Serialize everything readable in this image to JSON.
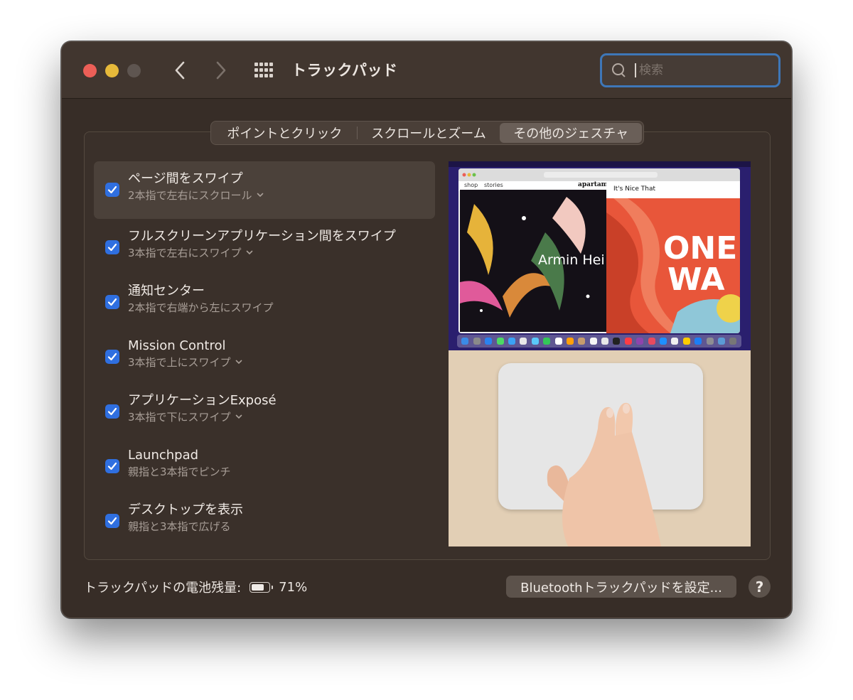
{
  "window": {
    "title": "トラックパッド",
    "traffic_colors": {
      "close": "#ec5f57",
      "minimize": "#e6b93a",
      "zoom": "#5e5550"
    }
  },
  "toolbar": {
    "back_icon": "chevron-left-icon",
    "forward_icon": "chevron-right-icon",
    "grid_icon": "grid-icon"
  },
  "search": {
    "placeholder": "検索",
    "value": ""
  },
  "tabs": [
    {
      "label": "ポイントとクリック",
      "selected": false
    },
    {
      "label": "スクロールとズーム",
      "selected": false
    },
    {
      "label": "その他のジェスチャ",
      "selected": true
    }
  ],
  "gestures": [
    {
      "title": "ページ間をスワイプ",
      "subtitle": "2本指で左右にスクロール",
      "checked": true,
      "has_menu": true,
      "selected": true
    },
    {
      "title": "フルスクリーンアプリケーション間をスワイプ",
      "subtitle": "3本指で左右にスワイプ",
      "checked": true,
      "has_menu": true,
      "selected": false
    },
    {
      "title": "通知センター",
      "subtitle": "2本指で右端から左にスワイプ",
      "checked": true,
      "has_menu": false,
      "selected": false
    },
    {
      "title": "Mission Control",
      "subtitle": "3本指で上にスワイプ",
      "checked": true,
      "has_menu": true,
      "selected": false
    },
    {
      "title": "アプリケーションExposé",
      "subtitle": "3本指で下にスワイプ",
      "checked": true,
      "has_menu": true,
      "selected": false
    },
    {
      "title": "Launchpad",
      "subtitle": "親指と3本指でピンチ",
      "checked": true,
      "has_menu": false,
      "selected": false
    },
    {
      "title": "デスクトップを表示",
      "subtitle": "親指と3本指で広げる",
      "checked": true,
      "has_menu": false,
      "selected": false
    }
  ],
  "preview": {
    "site_nav_left": "shop",
    "site_nav_right": "stories",
    "site_brand": "apartame",
    "site_brand2": "It's Nice That",
    "art_text_left": "Armin Hei",
    "art_text_right_1": "ONE",
    "art_text_right_2": "WA"
  },
  "footer": {
    "battery_label": "トラックパッドの電池残量:",
    "battery_percent": "71%",
    "battery_level": 0.71,
    "bluetooth_button": "Bluetoothトラックパッドを設定...",
    "help_button": "?"
  },
  "colors": {
    "accent": "#2f6fe0",
    "search_focus": "#3e77b8",
    "window_bg": "#372d27"
  }
}
